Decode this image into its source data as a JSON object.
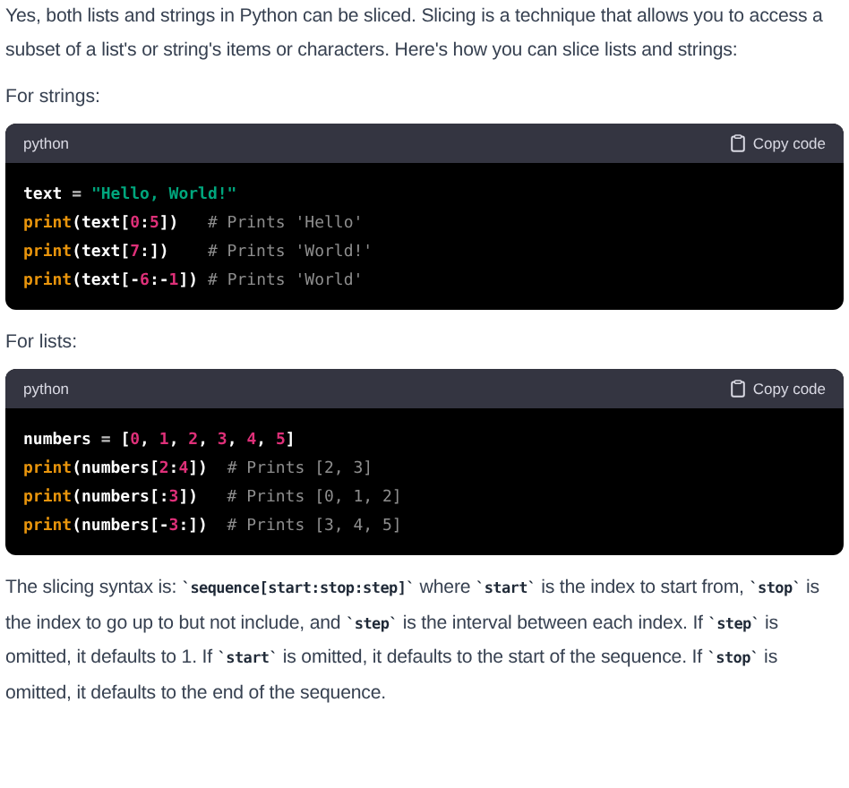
{
  "intro": "Yes, both lists and strings in Python can be sliced. Slicing is a technique that allows you to access a subset of a list's or string's items or characters. Here's how you can slice lists and strings:",
  "sections": [
    {
      "heading": "For strings:",
      "code": {
        "language": "python",
        "copy_label": "Copy code",
        "lines": [
          [
            {
              "kind": "plain",
              "text": "text "
            },
            {
              "kind": "op",
              "text": "= "
            },
            {
              "kind": "string",
              "text": "\"Hello, World!\""
            }
          ],
          [
            {
              "kind": "keyword",
              "text": "print"
            },
            {
              "kind": "plain",
              "text": "(text["
            },
            {
              "kind": "number",
              "text": "0"
            },
            {
              "kind": "plain",
              "text": ":"
            },
            {
              "kind": "number",
              "text": "5"
            },
            {
              "kind": "plain",
              "text": "])   "
            },
            {
              "kind": "comment",
              "text": "# Prints 'Hello'"
            }
          ],
          [
            {
              "kind": "keyword",
              "text": "print"
            },
            {
              "kind": "plain",
              "text": "(text["
            },
            {
              "kind": "number",
              "text": "7"
            },
            {
              "kind": "plain",
              "text": ":])    "
            },
            {
              "kind": "comment",
              "text": "# Prints 'World!'"
            }
          ],
          [
            {
              "kind": "keyword",
              "text": "print"
            },
            {
              "kind": "plain",
              "text": "(text[-"
            },
            {
              "kind": "number",
              "text": "6"
            },
            {
              "kind": "plain",
              "text": ":-"
            },
            {
              "kind": "number",
              "text": "1"
            },
            {
              "kind": "plain",
              "text": "]) "
            },
            {
              "kind": "comment",
              "text": "# Prints 'World'"
            }
          ]
        ]
      }
    },
    {
      "heading": "For lists:",
      "code": {
        "language": "python",
        "copy_label": "Copy code",
        "lines": [
          [
            {
              "kind": "plain",
              "text": "numbers "
            },
            {
              "kind": "op",
              "text": "= "
            },
            {
              "kind": "plain",
              "text": "["
            },
            {
              "kind": "number",
              "text": "0"
            },
            {
              "kind": "plain",
              "text": ", "
            },
            {
              "kind": "number",
              "text": "1"
            },
            {
              "kind": "plain",
              "text": ", "
            },
            {
              "kind": "number",
              "text": "2"
            },
            {
              "kind": "plain",
              "text": ", "
            },
            {
              "kind": "number",
              "text": "3"
            },
            {
              "kind": "plain",
              "text": ", "
            },
            {
              "kind": "number",
              "text": "4"
            },
            {
              "kind": "plain",
              "text": ", "
            },
            {
              "kind": "number",
              "text": "5"
            },
            {
              "kind": "plain",
              "text": "]"
            }
          ],
          [
            {
              "kind": "keyword",
              "text": "print"
            },
            {
              "kind": "plain",
              "text": "(numbers["
            },
            {
              "kind": "number",
              "text": "2"
            },
            {
              "kind": "plain",
              "text": ":"
            },
            {
              "kind": "number",
              "text": "4"
            },
            {
              "kind": "plain",
              "text": "])  "
            },
            {
              "kind": "comment",
              "text": "# Prints [2, 3]"
            }
          ],
          [
            {
              "kind": "keyword",
              "text": "print"
            },
            {
              "kind": "plain",
              "text": "(numbers[:"
            },
            {
              "kind": "number",
              "text": "3"
            },
            {
              "kind": "plain",
              "text": "])   "
            },
            {
              "kind": "comment",
              "text": "# Prints [0, 1, 2]"
            }
          ],
          [
            {
              "kind": "keyword",
              "text": "print"
            },
            {
              "kind": "plain",
              "text": "(numbers[-"
            },
            {
              "kind": "number",
              "text": "3"
            },
            {
              "kind": "plain",
              "text": ":])  "
            },
            {
              "kind": "comment",
              "text": "# Prints [3, 4, 5]"
            }
          ]
        ]
      }
    }
  ],
  "explanation": "The slicing syntax is: **`sequence[start:stop:step]`** where **`start`** is the index to start from, **`stop`** is the index to go up to but not include, and **`step`** is the interval between each index. If **`step`** is omitted, it defaults to 1. If **`start`** is omitted, it defaults to the start of the sequence. If **`stop`** is omitted, it defaults to the end of the sequence."
}
